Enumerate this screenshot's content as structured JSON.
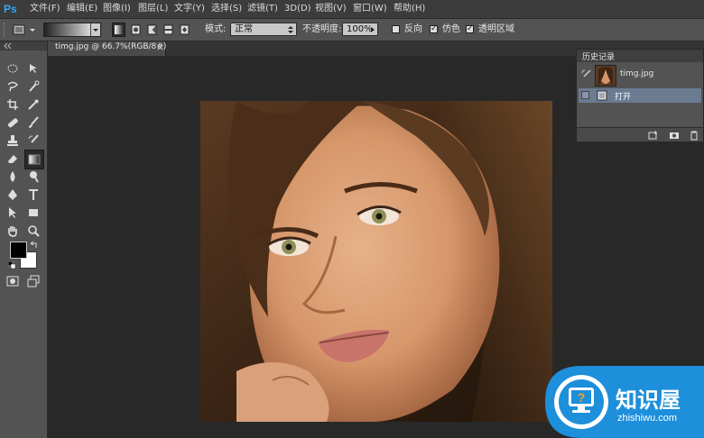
{
  "app": {
    "logo": "Ps"
  },
  "menu": {
    "items": [
      "文件(F)",
      "编辑(E)",
      "图像(I)",
      "图层(L)",
      "文字(Y)",
      "选择(S)",
      "滤镜(T)",
      "3D(D)",
      "视图(V)",
      "窗口(W)",
      "帮助(H)"
    ]
  },
  "options": {
    "mode_label": "模式:",
    "mode_value": "正常",
    "opacity_label": "不透明度:",
    "opacity_value": "100%",
    "reverse_label": "反向",
    "dither_label": "仿色",
    "transparency_label": "透明区域"
  },
  "document": {
    "tab_title": "timg.jpg @ 66.7%(RGB/8#)",
    "tab_close": "×"
  },
  "history": {
    "title": "历史记录",
    "snapshot_name": "timg.jpg",
    "steps": [
      "打开"
    ]
  },
  "brand": {
    "name": "知识屋",
    "url": "zhishiwu.com"
  },
  "colors": {
    "accent": "#31a8ff",
    "brand_blue": "#1d8fdb",
    "brand_orange": "#f7a51d"
  }
}
